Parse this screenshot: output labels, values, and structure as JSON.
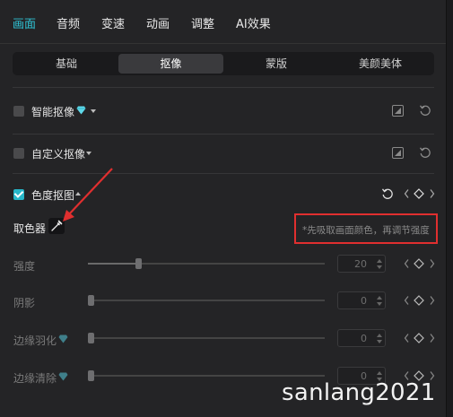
{
  "topnav": {
    "tabs": [
      "画面",
      "音频",
      "变速",
      "动画",
      "调整",
      "AI效果"
    ],
    "active": "画面"
  },
  "subtabs": {
    "items": [
      "基础",
      "抠像",
      "蒙版",
      "美颜美体"
    ],
    "active": "抠像"
  },
  "sections": {
    "smart": {
      "label": "智能抠像"
    },
    "custom": {
      "label": "自定义抠像"
    },
    "chroma": {
      "label": "色度抠图",
      "checked": true
    }
  },
  "picker": {
    "label": "取色器",
    "hint": "*先吸取画面颜色，再调节强度"
  },
  "params": [
    {
      "label": "强度",
      "value": "20",
      "level": 0.2
    },
    {
      "label": "阴影",
      "value": "0",
      "level": 0
    },
    {
      "label": "边缘羽化",
      "value": "0",
      "level": 0
    },
    {
      "label": "边缘清除",
      "value": "0",
      "level": 0
    }
  ],
  "colors": {
    "accent": "#2fc4d6",
    "highlight": "#e02f2f",
    "gem": "#5fd9ea"
  },
  "icons": {
    "reset": "reset-icon",
    "mirror": "mirror-icon",
    "gem": "diamond-icon",
    "eyedropper": "eyedropper-icon",
    "keyframe": "keyframe-diamond-icon"
  },
  "watermark": "sanlang2021"
}
